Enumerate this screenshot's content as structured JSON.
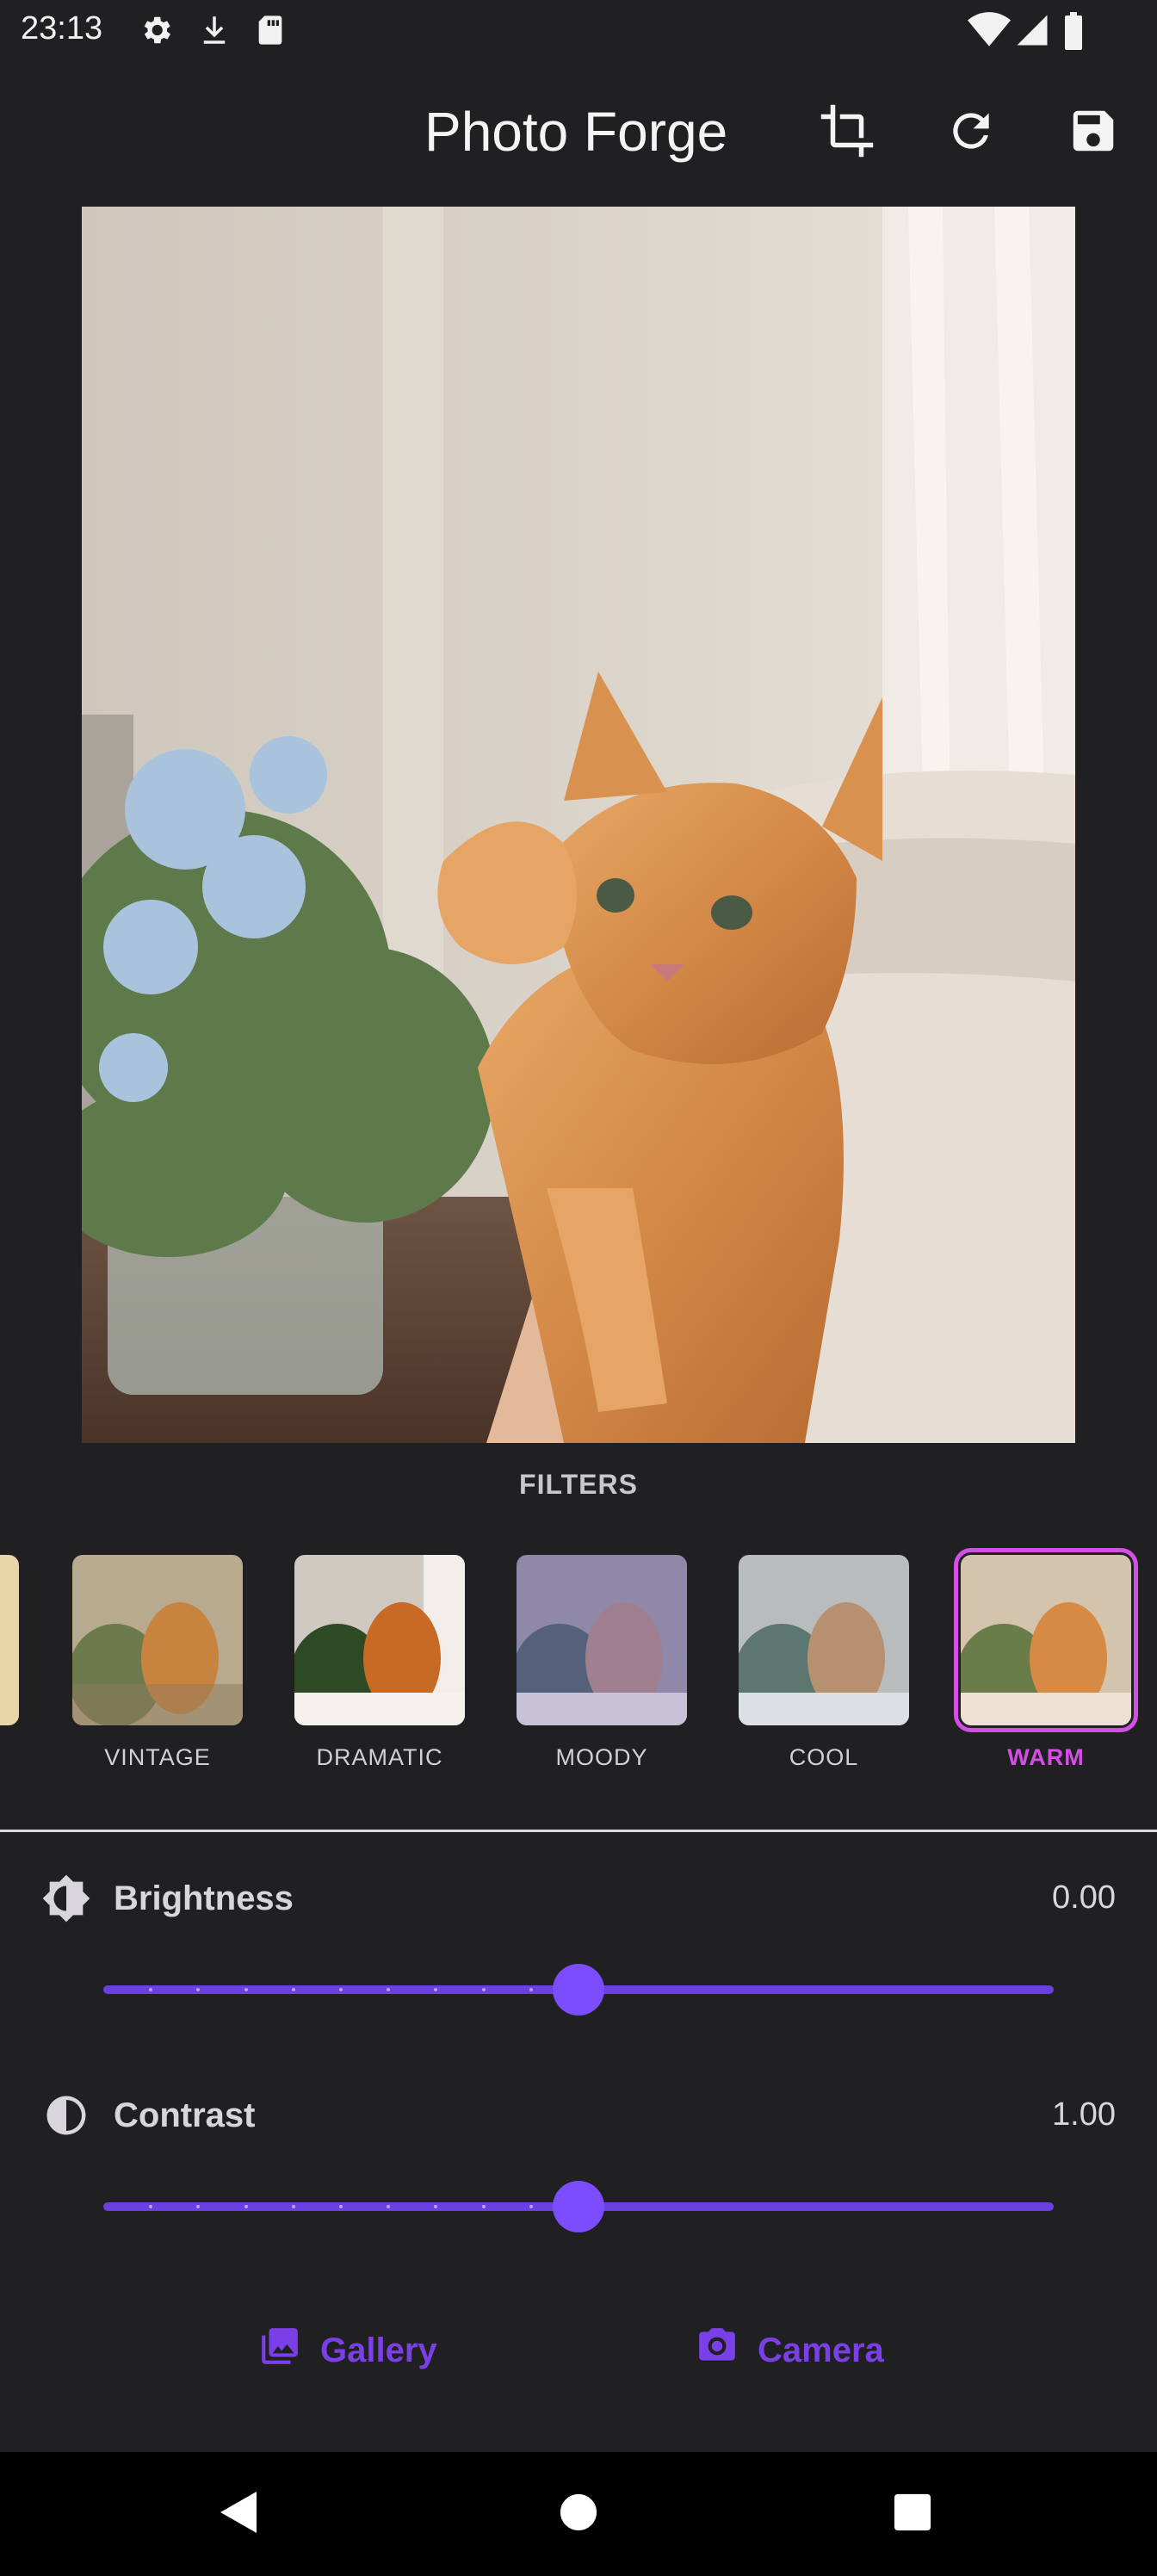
{
  "status_bar": {
    "time": "23:13",
    "icons": [
      "settings-icon",
      "download-icon",
      "sd-card-icon",
      "wifi-icon",
      "signal-icon",
      "battery-icon"
    ]
  },
  "app_bar": {
    "title": "Photo Forge",
    "actions": [
      "crop-icon",
      "rotate-icon",
      "save-icon"
    ]
  },
  "photo": {
    "description_icon": "kitten-photo"
  },
  "filters": {
    "title": "FILTERS",
    "items": [
      {
        "label": "VINTAGE",
        "selected": false
      },
      {
        "label": "DRAMATIC",
        "selected": false
      },
      {
        "label": "MOODY",
        "selected": false
      },
      {
        "label": "COOL",
        "selected": false
      },
      {
        "label": "WARM",
        "selected": true
      }
    ]
  },
  "adjustments": {
    "brightness": {
      "label": "Brightness",
      "value_text": "0.00",
      "value": 0.5
    },
    "contrast": {
      "label": "Contrast",
      "value_text": "1.00",
      "value": 0.5
    }
  },
  "buttons": {
    "gallery_label": "Gallery",
    "camera_label": "Camera"
  },
  "colors": {
    "accent": "#7c4dff",
    "selected_filter": "#d44fe6",
    "background": "#202022"
  }
}
